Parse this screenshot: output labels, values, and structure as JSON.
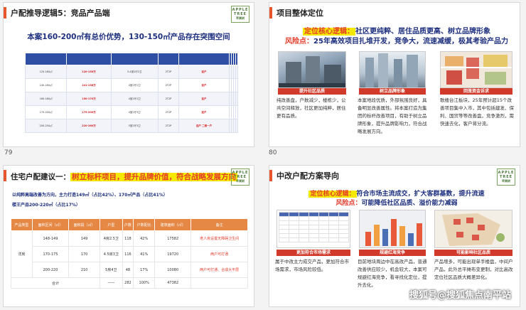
{
  "slide1": {
    "title": "户配推导逻辑5：竞品产品端",
    "headline": "本案160-200㎡有总价优势，130-150㎡产品存在突围空间",
    "logo": [
      "APPLE",
      "TREE",
      "苹果树"
    ],
    "rows": [
      {
        "a": "120-160㎡",
        "b": "120-150万",
        "c": "3-4室2厅2卫",
        "d": "2T2P",
        "e": "迎户"
      },
      {
        "a": "140-160㎡",
        "b": "141-158万",
        "c": "4室2厅2卫",
        "d": "2T2P",
        "e": "迎户"
      },
      {
        "a": "160-180㎡",
        "b": "150-170万",
        "c": "4室2厅2卫",
        "d": "2T2P",
        "e": "迎户"
      },
      {
        "a": "170-200㎡",
        "b": "175-200万",
        "c": "4室2厅3卫",
        "d": "2T2P",
        "e": "迎户"
      },
      {
        "a": "200-250㎡",
        "b": "220-260万",
        "c": "5室2厅3卫",
        "d": "2T2P",
        "e": "迎户 二梯一户"
      }
    ]
  },
  "slide2": {
    "title": "项目整体定位",
    "core_label": "定位核心逻辑：",
    "core_text": "社区更纯粹、居住品质更高、树立品牌形象",
    "risk_label": "风险点：",
    "risk_text": "25年高效项目扎堆开发，竞争大，流速减缓，极其考验产品力",
    "cards": [
      {
        "caption": "提升社区品质",
        "text": "纯改善盘，户数减少，楼栋少，公共空间释放，社区更加纯粹，居住更有品质。"
      },
      {
        "caption": "树立品牌形象",
        "text": "本案地段优质，外部氛围良好，具备明显改善属性。将本案打造为集团的标杆改善项目，有助于树立品牌形象，提升品牌影响力，符合战略发展方向。"
      },
      {
        "caption": "回笼资金诉求",
        "text": "歌楼台江板块，25年预计超15个改善项目集中入市，其中包括建发、保利、国贸等等改善盘，竞争激烈，需快速去化，客户将分流。"
      }
    ]
  },
  "slide3": {
    "title_prefix": "住宅户配建议一：",
    "title_hl": "树立标杆项目，提升品牌价值，符合战略发展方向",
    "logo": [
      "APPLE",
      "TREE",
      "苹果树"
    ],
    "info1": "以纯粹高端改善为方向，主力打造149㎡（占比42%）、170㎡产品（占比41%）",
    "info2": "楼王产品200-220㎡（占比17%）",
    "headers": [
      "产品类型",
      "面积区间（㎡）",
      "面积段（㎡）",
      "户型",
      "户数",
      "户数配比",
      "建筑面积（㎡）",
      "备注"
    ],
    "category": "洋房",
    "rows": [
      {
        "range": "148-149",
        "area": "149",
        "type": "4房2.5卫",
        "units": "118",
        "ratio": "42%",
        "gfa": "17582",
        "note": "老人房设置无障碍卫生间"
      },
      {
        "range": "170-175",
        "area": "170",
        "type": "4.5房3卫",
        "units": "116",
        "ratio": "41%",
        "gfa": "19720",
        "note": "两户可打通"
      },
      {
        "range": "200-220",
        "area": "210",
        "type": "5房4卫",
        "units": "48",
        "ratio": "17%",
        "gfa": "10080",
        "note": "两户可打通、合成大平层"
      }
    ],
    "total": {
      "label": "合计",
      "area": "——",
      "units": "282",
      "ratio": "100%",
      "gfa": "47382"
    }
  },
  "slide4": {
    "title": "中改户配方案导向",
    "logo": [
      "APPLE",
      "TREE",
      "苹果树"
    ],
    "core_label": "定位核心逻辑：",
    "core_text": "符合市场主流成交，扩大客群基数，提升流速",
    "risk_label": "风险点：",
    "risk_text": "可能降低社区品质、溢价能力减弱",
    "cards": [
      {
        "caption": "更加符合市场需求",
        "text": "属于中改主力成交产品，更加符合市场需求，市场风险较低。"
      },
      {
        "caption": "规避红海竞争",
        "text": "目前地块周边中在高改产品，普通改善供应较少，机会较大，本案可规避红海竞争，看寻找化定位，提升去化。"
      },
      {
        "caption": "可能影响社区品质",
        "text": "产品增多，可能出现单手楼盘，中间户产品，此外总平摊布变更制，对比高改定位社区品质大概差异化。"
      }
    ],
    "watermark": "搜狐号@搜狐焦点南平站"
  },
  "page_numbers": [
    "79",
    "80"
  ]
}
